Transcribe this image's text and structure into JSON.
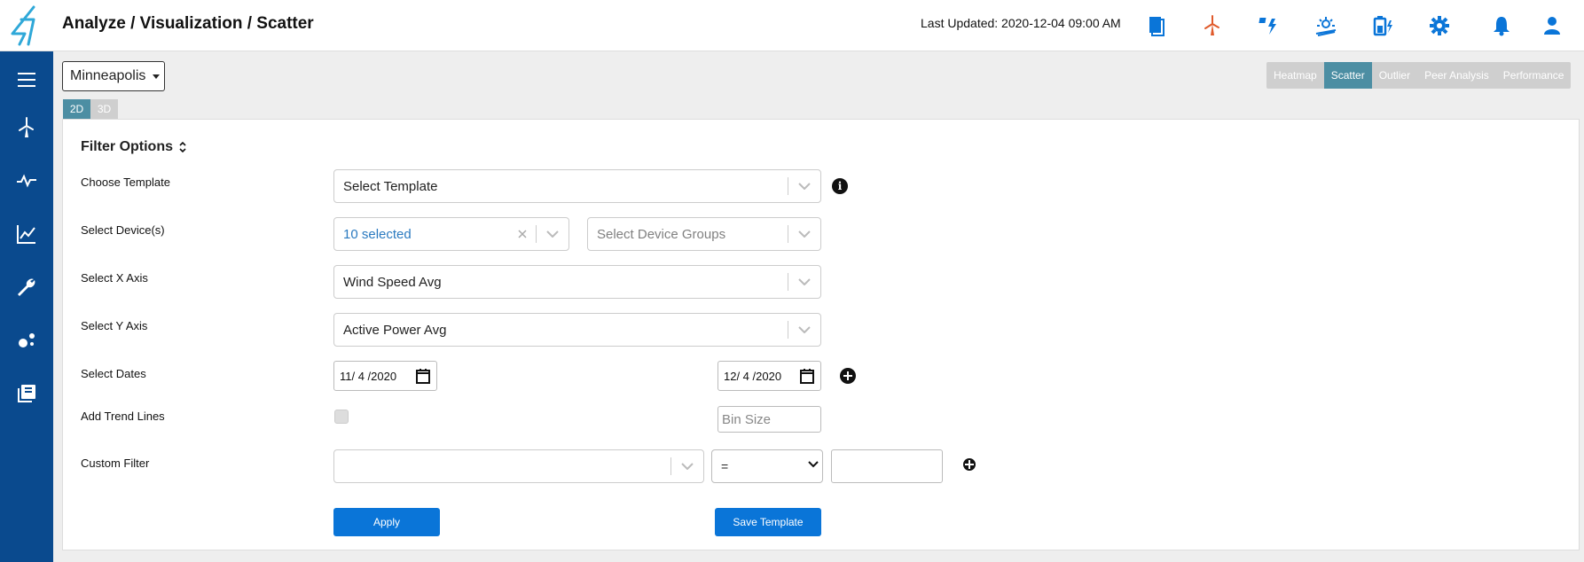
{
  "header": {
    "title": "Analyze / Visualization / Scatter",
    "last_updated": "Last Updated: 2020-12-04 09:00 AM",
    "icons": [
      "reports-icon",
      "wind-turbine-icon",
      "solar-storm-icon",
      "solar-panel-icon",
      "battery-icon",
      "settings-icon",
      "notifications-icon",
      "user-icon"
    ],
    "colors": {
      "blue": "#0a75d8",
      "orange": "#e05a2b"
    }
  },
  "sidebar": {
    "items": [
      "menu-icon",
      "wind-turbine-icon",
      "activity-icon",
      "chart-icon",
      "wrench-icon",
      "scatter-icon",
      "library-icon"
    ],
    "background": "#0a4a8e"
  },
  "location": {
    "label": "Minneapolis"
  },
  "view_tabs": [
    {
      "label": "Heatmap",
      "active": false
    },
    {
      "label": "Scatter",
      "active": true
    },
    {
      "label": "Outlier",
      "active": false
    },
    {
      "label": "Peer Analysis",
      "active": false
    },
    {
      "label": "Performance",
      "active": false
    }
  ],
  "dim_tabs": [
    {
      "label": "2D",
      "active": true
    },
    {
      "label": "3D",
      "active": false
    }
  ],
  "filters": {
    "title": "Filter Options",
    "choose_template": {
      "label": "Choose Template",
      "value": "Select Template"
    },
    "devices": {
      "label": "Select Device(s)",
      "value": "10 selected",
      "groups_placeholder": "Select Device Groups"
    },
    "x_axis": {
      "label": "Select X Axis",
      "value": "Wind Speed Avg"
    },
    "y_axis": {
      "label": "Select Y Axis",
      "value": "Active Power Avg"
    },
    "dates": {
      "label": "Select Dates",
      "start": "11/ 4 /2020",
      "end": "12/ 4 /2020"
    },
    "trend_lines": {
      "label": "Add Trend Lines",
      "checked": false,
      "bin_size_placeholder": "Bin Size"
    },
    "custom_filter": {
      "label": "Custom Filter",
      "field_value": "",
      "operator": "=",
      "value": ""
    }
  },
  "buttons": {
    "apply": "Apply",
    "save_template": "Save Template"
  }
}
